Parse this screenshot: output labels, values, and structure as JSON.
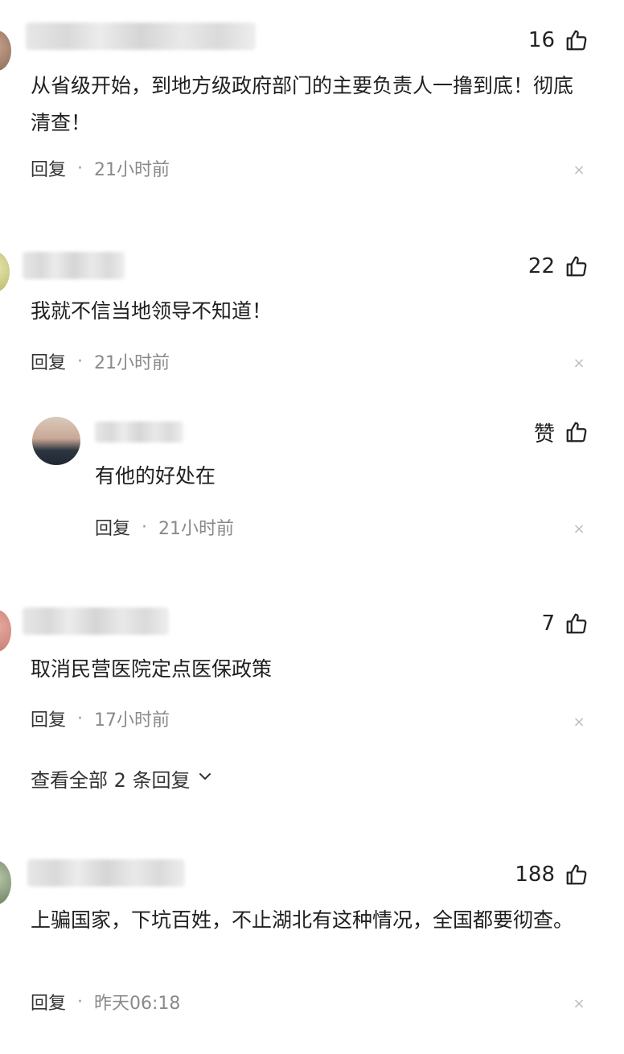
{
  "colors": {
    "background": "#ffffff",
    "text": "#1f1f1f",
    "meta": "#8a8a8a",
    "close": "#bdbdbd"
  },
  "comments": [
    {
      "likes": "16",
      "text": "从省级开始，到地方级政府部门的主要负责人一撸到底！彻底清查！",
      "reply": "回复",
      "time": "21小时前"
    },
    {
      "likes": "22",
      "text": "我就不信当地领导不知道！",
      "reply": "回复",
      "time": "21小时前",
      "replies": [
        {
          "likes": "赞",
          "text": "有他的好处在",
          "reply": "回复",
          "time": "21小时前"
        }
      ]
    },
    {
      "likes": "7",
      "text": "取消民营医院定点医保政策",
      "reply": "回复",
      "time": "17小时前",
      "view_all": "查看全部 2 条回复"
    },
    {
      "likes": "188",
      "text": "上骗国家，下坑百姓，不止湖北有这种情况，全国都要彻查。",
      "reply": "回复",
      "time": "昨天06:18"
    }
  ],
  "icons": {
    "like": "thumbs-up-icon",
    "close": "close-icon",
    "chevron": "chevron-down-icon",
    "separator": "·"
  }
}
